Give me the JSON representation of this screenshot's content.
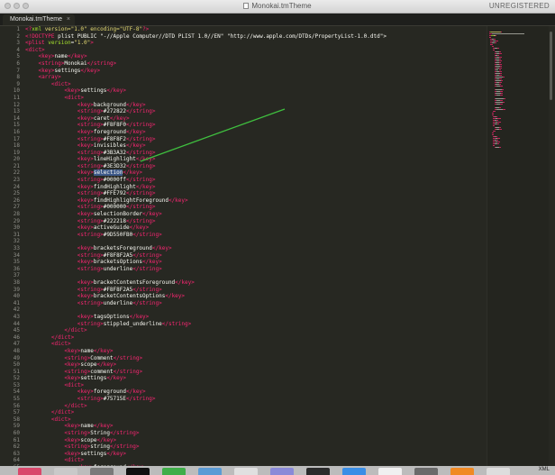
{
  "window": {
    "title": "Monokai.tmTheme",
    "unregistered": "UNREGISTERED"
  },
  "tabs": [
    {
      "label": "Monokai.tmTheme",
      "close": "×"
    }
  ],
  "editor": {
    "lines": [
      [
        [
          "t",
          "<?"
        ],
        [
          "a",
          "xml"
        ],
        [
          "s",
          " version=\"1.0\" encoding=\"UTF-8\""
        ],
        [
          "t",
          "?>"
        ]
      ],
      [
        [
          "t",
          "<!DOCTYPE"
        ],
        [
          "p",
          " plist PUBLIC \"-//Apple Computer//DTD PLIST 1.0//EN\" \"http://www.apple.com/DTDs/PropertyList-1.0.dtd\">"
        ]
      ],
      [
        [
          "t",
          "<plist"
        ],
        [
          "a",
          " version"
        ],
        [
          "p",
          "="
        ],
        [
          "s",
          "\"1.0\""
        ],
        [
          "t",
          ">"
        ]
      ],
      [
        [
          "t",
          "<dict>"
        ]
      ],
      [
        [
          "p",
          "    "
        ],
        [
          "t",
          "<key>"
        ],
        [
          "p",
          "name"
        ],
        [
          "t",
          "</key>"
        ]
      ],
      [
        [
          "p",
          "    "
        ],
        [
          "t",
          "<string>"
        ],
        [
          "p",
          "Monokai"
        ],
        [
          "t",
          "</string>"
        ]
      ],
      [
        [
          "p",
          "    "
        ],
        [
          "t",
          "<key>"
        ],
        [
          "p",
          "settings"
        ],
        [
          "t",
          "</key>"
        ]
      ],
      [
        [
          "p",
          "    "
        ],
        [
          "t",
          "<array>"
        ]
      ],
      [
        [
          "p",
          "        "
        ],
        [
          "t",
          "<dict>"
        ]
      ],
      [
        [
          "p",
          "            "
        ],
        [
          "t",
          "<key>"
        ],
        [
          "p",
          "settings"
        ],
        [
          "t",
          "</key>"
        ]
      ],
      [
        [
          "p",
          "            "
        ],
        [
          "t",
          "<dict>"
        ]
      ],
      [
        [
          "p",
          "                "
        ],
        [
          "t",
          "<key>"
        ],
        [
          "p",
          "background"
        ],
        [
          "t",
          "</key>"
        ]
      ],
      [
        [
          "p",
          "                "
        ],
        [
          "t",
          "<string>"
        ],
        [
          "p",
          "#272822"
        ],
        [
          "t",
          "</string>"
        ]
      ],
      [
        [
          "p",
          "                "
        ],
        [
          "t",
          "<key>"
        ],
        [
          "p",
          "caret"
        ],
        [
          "t",
          "</key>"
        ]
      ],
      [
        [
          "p",
          "                "
        ],
        [
          "t",
          "<string>"
        ],
        [
          "p",
          "#F8F8F0"
        ],
        [
          "t",
          "</string>"
        ]
      ],
      [
        [
          "p",
          "                "
        ],
        [
          "t",
          "<key>"
        ],
        [
          "p",
          "foreground"
        ],
        [
          "t",
          "</key>"
        ]
      ],
      [
        [
          "p",
          "                "
        ],
        [
          "t",
          "<string>"
        ],
        [
          "p",
          "#F8F8F2"
        ],
        [
          "t",
          "</string>"
        ]
      ],
      [
        [
          "p",
          "                "
        ],
        [
          "t",
          "<key>"
        ],
        [
          "p",
          "invisibles"
        ],
        [
          "t",
          "</key>"
        ]
      ],
      [
        [
          "p",
          "                "
        ],
        [
          "t",
          "<string>"
        ],
        [
          "p",
          "#3B3A32"
        ],
        [
          "t",
          "</string>"
        ]
      ],
      [
        [
          "p",
          "                "
        ],
        [
          "t",
          "<key>"
        ],
        [
          "p",
          "lineHighlight"
        ],
        [
          "t",
          "</key>"
        ]
      ],
      [
        [
          "p",
          "                "
        ],
        [
          "t",
          "<string>"
        ],
        [
          "p",
          "#3E3D32"
        ],
        [
          "t",
          "</string>"
        ]
      ],
      [
        [
          "p",
          "                "
        ],
        [
          "t",
          "<key>"
        ],
        [
          "sel",
          "selection"
        ],
        [
          "t",
          "</key>"
        ]
      ],
      [
        [
          "p",
          "                "
        ],
        [
          "t",
          "<string>"
        ],
        [
          "p",
          "#0000ff"
        ],
        [
          "t",
          "</string>"
        ]
      ],
      [
        [
          "p",
          "                "
        ],
        [
          "t",
          "<key>"
        ],
        [
          "p",
          "findHighlight"
        ],
        [
          "t",
          "</key>"
        ]
      ],
      [
        [
          "p",
          "                "
        ],
        [
          "t",
          "<string>"
        ],
        [
          "p",
          "#FFE792"
        ],
        [
          "t",
          "</string>"
        ]
      ],
      [
        [
          "p",
          "                "
        ],
        [
          "t",
          "<key>"
        ],
        [
          "p",
          "findHighlightForeground"
        ],
        [
          "t",
          "</key>"
        ]
      ],
      [
        [
          "p",
          "                "
        ],
        [
          "t",
          "<string>"
        ],
        [
          "p",
          "#000000"
        ],
        [
          "t",
          "</string>"
        ]
      ],
      [
        [
          "p",
          "                "
        ],
        [
          "t",
          "<key>"
        ],
        [
          "p",
          "selectionBorder"
        ],
        [
          "t",
          "</key>"
        ]
      ],
      [
        [
          "p",
          "                "
        ],
        [
          "t",
          "<string>"
        ],
        [
          "p",
          "#222218"
        ],
        [
          "t",
          "</string>"
        ]
      ],
      [
        [
          "p",
          "                "
        ],
        [
          "t",
          "<key>"
        ],
        [
          "p",
          "activeGuide"
        ],
        [
          "t",
          "</key>"
        ]
      ],
      [
        [
          "p",
          "                "
        ],
        [
          "t",
          "<string>"
        ],
        [
          "p",
          "#9D550FB0"
        ],
        [
          "t",
          "</string>"
        ]
      ],
      [],
      [
        [
          "p",
          "                "
        ],
        [
          "t",
          "<key>"
        ],
        [
          "p",
          "bracketsForeground"
        ],
        [
          "t",
          "</key>"
        ]
      ],
      [
        [
          "p",
          "                "
        ],
        [
          "t",
          "<string>"
        ],
        [
          "p",
          "#F8F8F2A5"
        ],
        [
          "t",
          "</string>"
        ]
      ],
      [
        [
          "p",
          "                "
        ],
        [
          "t",
          "<key>"
        ],
        [
          "p",
          "bracketsOptions"
        ],
        [
          "t",
          "</key>"
        ]
      ],
      [
        [
          "p",
          "                "
        ],
        [
          "t",
          "<string>"
        ],
        [
          "p",
          "underline"
        ],
        [
          "t",
          "</string>"
        ]
      ],
      [],
      [
        [
          "p",
          "                "
        ],
        [
          "t",
          "<key>"
        ],
        [
          "p",
          "bracketContentsForeground"
        ],
        [
          "t",
          "</key>"
        ]
      ],
      [
        [
          "p",
          "                "
        ],
        [
          "t",
          "<string>"
        ],
        [
          "p",
          "#F8F8F2A5"
        ],
        [
          "t",
          "</string>"
        ]
      ],
      [
        [
          "p",
          "                "
        ],
        [
          "t",
          "<key>"
        ],
        [
          "p",
          "bracketContentsOptions"
        ],
        [
          "t",
          "</key>"
        ]
      ],
      [
        [
          "p",
          "                "
        ],
        [
          "t",
          "<string>"
        ],
        [
          "p",
          "underline"
        ],
        [
          "t",
          "</string>"
        ]
      ],
      [],
      [
        [
          "p",
          "                "
        ],
        [
          "t",
          "<key>"
        ],
        [
          "p",
          "tagsOptions"
        ],
        [
          "t",
          "</key>"
        ]
      ],
      [
        [
          "p",
          "                "
        ],
        [
          "t",
          "<string>"
        ],
        [
          "p",
          "stippled_underline"
        ],
        [
          "t",
          "</string>"
        ]
      ],
      [
        [
          "p",
          "            "
        ],
        [
          "t",
          "</dict>"
        ]
      ],
      [
        [
          "p",
          "        "
        ],
        [
          "t",
          "</dict>"
        ]
      ],
      [
        [
          "p",
          "        "
        ],
        [
          "t",
          "<dict>"
        ]
      ],
      [
        [
          "p",
          "            "
        ],
        [
          "t",
          "<key>"
        ],
        [
          "p",
          "name"
        ],
        [
          "t",
          "</key>"
        ]
      ],
      [
        [
          "p",
          "            "
        ],
        [
          "t",
          "<string>"
        ],
        [
          "p",
          "Comment"
        ],
        [
          "t",
          "</string>"
        ]
      ],
      [
        [
          "p",
          "            "
        ],
        [
          "t",
          "<key>"
        ],
        [
          "p",
          "scope"
        ],
        [
          "t",
          "</key>"
        ]
      ],
      [
        [
          "p",
          "            "
        ],
        [
          "t",
          "<string>"
        ],
        [
          "p",
          "comment"
        ],
        [
          "t",
          "</string>"
        ]
      ],
      [
        [
          "p",
          "            "
        ],
        [
          "t",
          "<key>"
        ],
        [
          "p",
          "settings"
        ],
        [
          "t",
          "</key>"
        ]
      ],
      [
        [
          "p",
          "            "
        ],
        [
          "t",
          "<dict>"
        ]
      ],
      [
        [
          "p",
          "                "
        ],
        [
          "t",
          "<key>"
        ],
        [
          "p",
          "foreground"
        ],
        [
          "t",
          "</key>"
        ]
      ],
      [
        [
          "p",
          "                "
        ],
        [
          "t",
          "<string>"
        ],
        [
          "p",
          "#75715E"
        ],
        [
          "t",
          "</string>"
        ]
      ],
      [
        [
          "p",
          "            "
        ],
        [
          "t",
          "</dict>"
        ]
      ],
      [
        [
          "p",
          "        "
        ],
        [
          "t",
          "</dict>"
        ]
      ],
      [
        [
          "p",
          "        "
        ],
        [
          "t",
          "<dict>"
        ]
      ],
      [
        [
          "p",
          "            "
        ],
        [
          "t",
          "<key>"
        ],
        [
          "p",
          "name"
        ],
        [
          "t",
          "</key>"
        ]
      ],
      [
        [
          "p",
          "            "
        ],
        [
          "t",
          "<string>"
        ],
        [
          "p",
          "String"
        ],
        [
          "t",
          "</string>"
        ]
      ],
      [
        [
          "p",
          "            "
        ],
        [
          "t",
          "<key>"
        ],
        [
          "p",
          "scope"
        ],
        [
          "t",
          "</key>"
        ]
      ],
      [
        [
          "p",
          "            "
        ],
        [
          "t",
          "<string>"
        ],
        [
          "p",
          "string"
        ],
        [
          "t",
          "</string>"
        ]
      ],
      [
        [
          "p",
          "            "
        ],
        [
          "t",
          "<key>"
        ],
        [
          "p",
          "settings"
        ],
        [
          "t",
          "</key>"
        ]
      ],
      [
        [
          "p",
          "            "
        ],
        [
          "t",
          "<dict>"
        ]
      ],
      [
        [
          "p",
          "                "
        ],
        [
          "t",
          "<key>"
        ],
        [
          "p",
          "foreground"
        ],
        [
          "t",
          "</key>"
        ]
      ]
    ]
  },
  "status": {
    "syntax": "XML"
  },
  "colors": {
    "editor_bg": "#272822",
    "tag": "#f92672",
    "attr": "#a6e22e",
    "string": "#e6db74",
    "text": "#f8f8f2",
    "gutter": "#90908a",
    "selection": "#3e5a8a",
    "annotation_arrow": "#3fbf3f"
  }
}
